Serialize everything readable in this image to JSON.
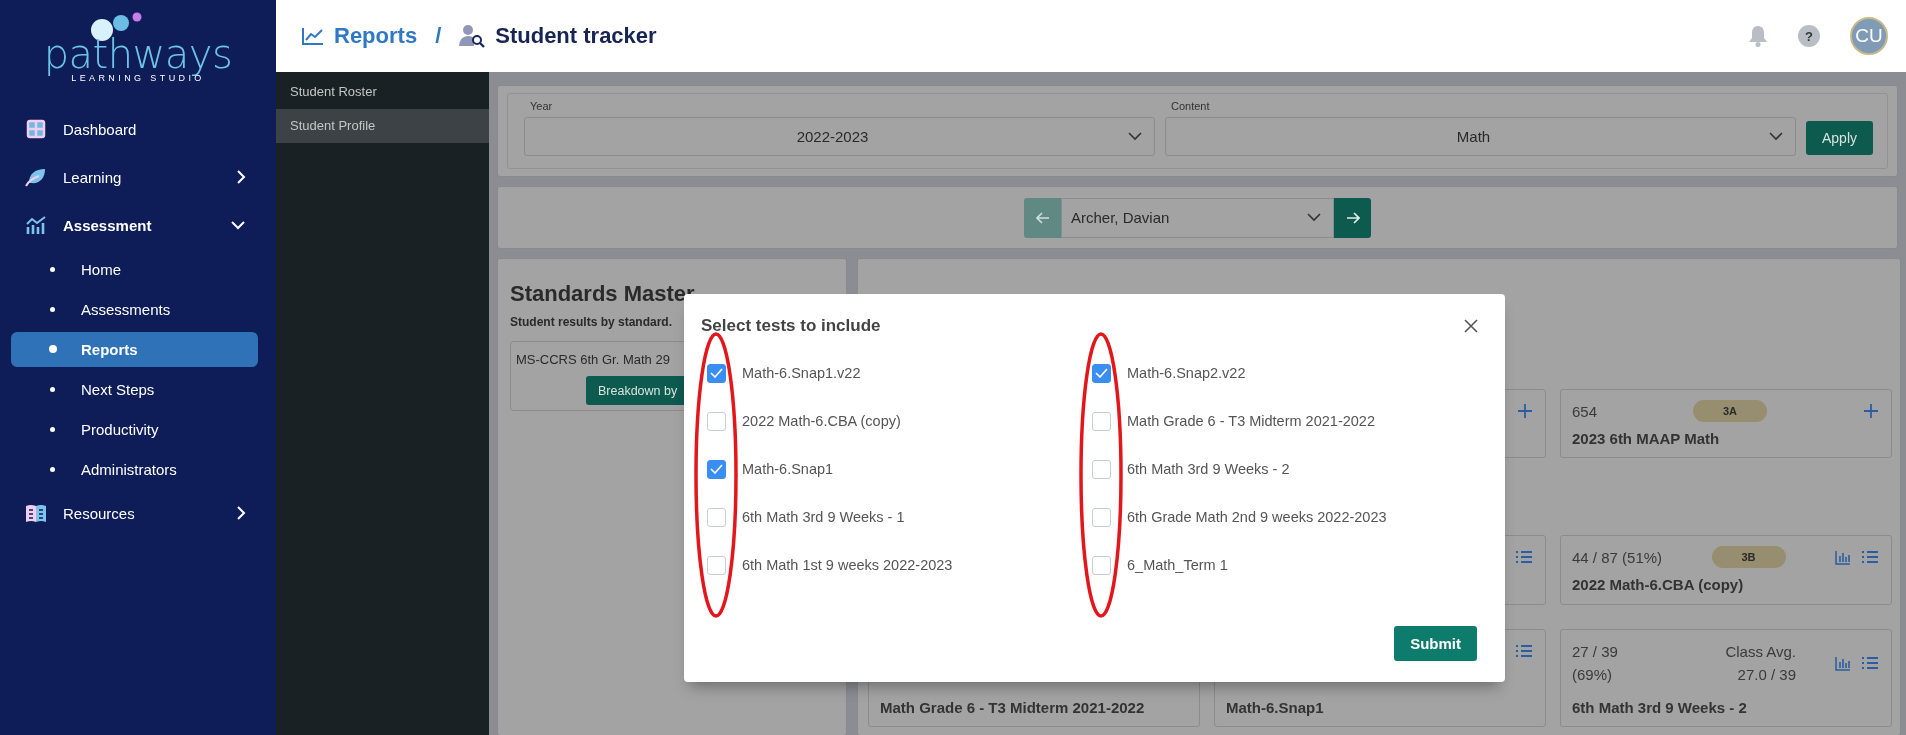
{
  "sidebar": {
    "logo": {
      "word": "pathways",
      "tagline": "LEARNING STUDIO"
    },
    "items": [
      {
        "label": "Dashboard",
        "expandable": false,
        "expanded": false
      },
      {
        "label": "Learning",
        "expandable": true,
        "expanded": false
      },
      {
        "label": "Assessment",
        "expandable": true,
        "expanded": true,
        "children": [
          {
            "label": "Home",
            "selected": false
          },
          {
            "label": "Assessments",
            "selected": false
          },
          {
            "label": "Reports",
            "selected": true
          },
          {
            "label": "Next Steps",
            "selected": false
          },
          {
            "label": "Productivity",
            "selected": false
          },
          {
            "label": "Administrators",
            "selected": false
          }
        ]
      },
      {
        "label": "Resources",
        "expandable": true,
        "expanded": false
      }
    ]
  },
  "header": {
    "breadcrumb": [
      {
        "label": "Reports",
        "kind": "link"
      },
      {
        "label": "Student tracker",
        "kind": "current"
      }
    ],
    "separator": "/",
    "help": "?",
    "avatar": "CU"
  },
  "subnav": [
    {
      "label": "Student Roster",
      "selected": false
    },
    {
      "label": "Student Profile",
      "selected": true
    }
  ],
  "filters": {
    "fields": [
      {
        "label": "Year",
        "value": "2022-2023"
      },
      {
        "label": "Content",
        "value": "Math"
      }
    ],
    "apply": "Apply"
  },
  "student_picker": {
    "value": "Archer, Davian"
  },
  "standards_card": {
    "title": "Standards Master",
    "subtitle": "Student results by standard.",
    "item": {
      "title": "MS-CCRS 6th Gr. Math 29",
      "button": "Breakdown by"
    }
  },
  "test_rows": [
    [
      {
        "kind": "add"
      },
      {
        "kind": "add",
        "score": "654",
        "badge": "3A",
        "title": "2023 6th MAAP Math"
      }
    ],
    [
      {
        "kind": "list"
      },
      {
        "kind": "report",
        "score": "44 / 87 (51%)",
        "badge": "3B",
        "title": "2022 Math-6.CBA (copy)"
      }
    ],
    [
      {
        "kind": "plain",
        "title": "Math Grade 6 - T3 Midterm 2021-2022"
      },
      {
        "kind": "list",
        "title": "Math-6.Snap1"
      },
      {
        "kind": "report",
        "score": "27 / 39 (69%)",
        "class_avg": "Class Avg. 27.0 / 39",
        "title": "6th Math 3rd 9 Weeks - 2"
      }
    ]
  ],
  "modal": {
    "title": "Select tests to include",
    "columns": [
      {
        "circled": true,
        "options": [
          {
            "label": "Math-6.Snap1.v22",
            "checked": true
          },
          {
            "label": "2022 Math-6.CBA (copy)",
            "checked": false
          },
          {
            "label": "Math-6.Snap1",
            "checked": true
          },
          {
            "label": "6th Math 3rd 9 Weeks - 1",
            "checked": false
          },
          {
            "label": "6th Math 1st 9 weeks 2022-2023",
            "checked": false
          }
        ]
      },
      {
        "circled": true,
        "options": [
          {
            "label": "Math-6.Snap2.v22",
            "checked": true
          },
          {
            "label": "Math Grade 6 - T3 Midterm 2021-2022",
            "checked": false
          },
          {
            "label": "6th Math 3rd 9 Weeks - 2",
            "checked": false
          },
          {
            "label": "6th Grade Math 2nd 9 weeks 2022-2023",
            "checked": false
          },
          {
            "label": "6_Math_Term 1",
            "checked": false
          }
        ]
      }
    ],
    "submit": "Submit"
  }
}
